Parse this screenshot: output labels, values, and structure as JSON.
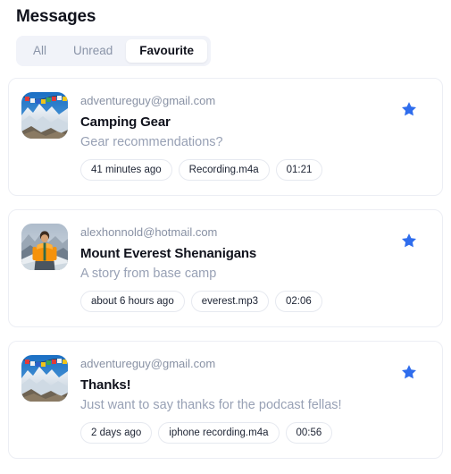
{
  "header": {
    "title": "Messages"
  },
  "tabs": {
    "items": [
      {
        "label": "All",
        "active": false
      },
      {
        "label": "Unread",
        "active": false
      },
      {
        "label": "Favourite",
        "active": true
      }
    ]
  },
  "colors": {
    "accent_star": "#2f6ded",
    "title_text": "#10121c",
    "email_text": "#8891a4",
    "preview_text": "#98a1b5",
    "card_border": "#eceef4",
    "chip_border": "#e6e9f0",
    "tabs_track": "#f1f3f9",
    "page_background": "#ffffff"
  },
  "messages": [
    {
      "email": "adventureguy@gmail.com",
      "subject": "Camping Gear",
      "preview": "Gear recommendations?",
      "chips": [
        "41 minutes ago",
        "Recording.m4a",
        "01:21"
      ],
      "favourite": true,
      "avatar": "everest-prayer-flags-thumbnail",
      "star_icon": "star-filled-icon"
    },
    {
      "email": "alexhonnold@hotmail.com",
      "subject": "Mount Everest Shenanigans",
      "preview": "A story from base camp",
      "chips": [
        "about 6 hours ago",
        "everest.mp3",
        "02:06"
      ],
      "favourite": true,
      "avatar": "climber-orange-jacket-thumbnail",
      "star_icon": "star-filled-icon"
    },
    {
      "email": "adventureguy@gmail.com",
      "subject": "Thanks!",
      "preview": "Just want to say thanks for the podcast fellas!",
      "chips": [
        "2 days ago",
        "iphone recording.m4a",
        "00:56"
      ],
      "favourite": true,
      "avatar": "everest-prayer-flags-thumbnail",
      "star_icon": "star-filled-icon"
    }
  ]
}
